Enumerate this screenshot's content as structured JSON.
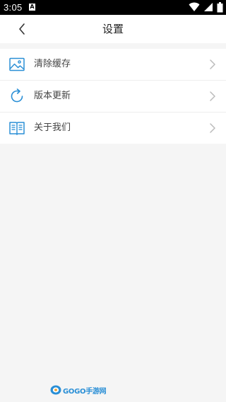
{
  "status_bar": {
    "time": "3:05",
    "notification_glyph": "A",
    "icons": [
      "wifi-icon",
      "signal-icon",
      "battery-icon"
    ]
  },
  "header": {
    "title": "设置",
    "back_icon": "chevron-left-icon"
  },
  "settings": {
    "items": [
      {
        "label": "清除缓存",
        "icon": "image-icon"
      },
      {
        "label": "版本更新",
        "icon": "refresh-icon"
      },
      {
        "label": "关于我们",
        "icon": "book-icon"
      }
    ]
  },
  "watermark": {
    "text": "GOGO手游网"
  },
  "colors": {
    "accent": "#2a8fd6",
    "background": "#f5f5f5",
    "chevron": "#bbbbbb"
  }
}
